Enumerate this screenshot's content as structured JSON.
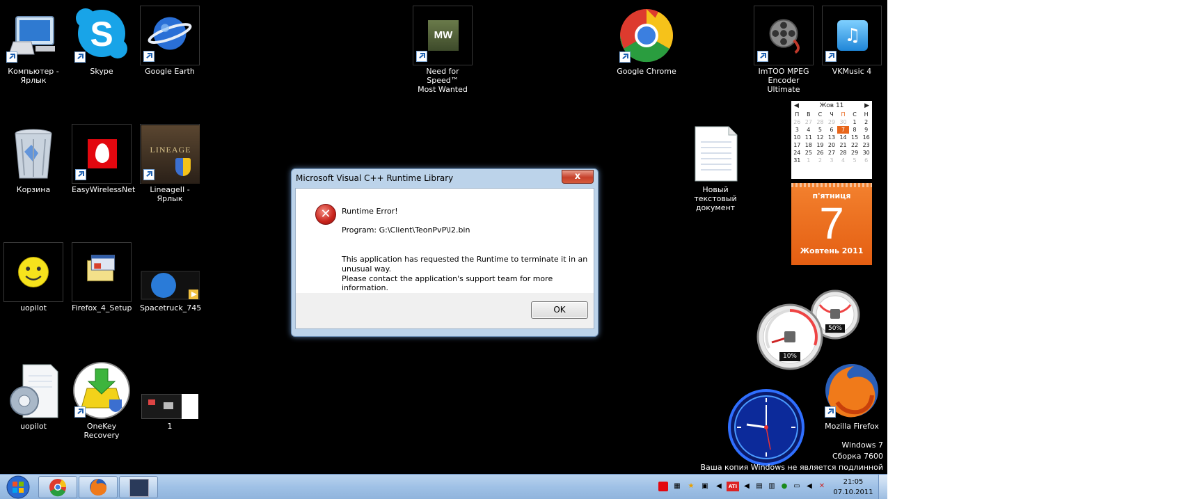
{
  "desktop": {
    "icons": [
      {
        "label": "Компьютер -\nЯрлык"
      },
      {
        "label": "Skype"
      },
      {
        "label": "Google Earth"
      },
      {
        "label": "Need for Speed™\nMost Wanted",
        "thumb_text": "MW"
      },
      {
        "label": "Google Chrome"
      },
      {
        "label": "ImTOO MPEG\nEncoder Ultimate"
      },
      {
        "label": "VKMusic 4"
      },
      {
        "label": "Корзина"
      },
      {
        "label": "EasyWirelessNet"
      },
      {
        "label": "LineageII - Ярлык",
        "thumb_text": "LINEAGE"
      },
      {
        "label": "Новый текстовый\nдокумент"
      },
      {
        "label": "uopilot"
      },
      {
        "label": "Firefox_4_Setup"
      },
      {
        "label": "Spacetruck_745"
      },
      {
        "label": "uopilot"
      },
      {
        "label": "OneKey Recovery"
      },
      {
        "label": "1"
      },
      {
        "label": "Mozilla Firefox"
      }
    ]
  },
  "dialog": {
    "title": "Microsoft Visual C++ Runtime Library",
    "close_glyph": "x",
    "heading": "Runtime Error!",
    "program": "Program: G:\\Client\\TeonPvP\\l2.bin",
    "message_line1": "This application has requested the Runtime to terminate it in an",
    "message_line2": "unusual way.",
    "message_line3": "Please contact the application's support team for more information.",
    "ok_label": "OK"
  },
  "calendar_gadget": {
    "month_header": "Жов 11",
    "weekday_headers": [
      "П",
      "В",
      "С",
      "Ч",
      "П",
      "С",
      "Н"
    ],
    "weeks": [
      [
        "26",
        "27",
        "28",
        "29",
        "30",
        "1",
        "2"
      ],
      [
        "3",
        "4",
        "5",
        "6",
        "7",
        "8",
        "9"
      ],
      [
        "10",
        "11",
        "12",
        "13",
        "14",
        "15",
        "16"
      ],
      [
        "17",
        "18",
        "19",
        "20",
        "21",
        "22",
        "23"
      ],
      [
        "24",
        "25",
        "26",
        "27",
        "28",
        "29",
        "30"
      ],
      [
        "31",
        "1",
        "2",
        "3",
        "4",
        "5",
        "6"
      ]
    ],
    "today": "7",
    "weekday_name": "п'ятниця",
    "big_day": "7",
    "month_year": "Жовтень 2011"
  },
  "cpu_meter": {
    "cpu": "10%",
    "memory": "50%"
  },
  "watermark": {
    "line1": "Windows 7",
    "line2": "Сборка 7600",
    "line3": "Ваша копия Windows не является подлинной"
  },
  "taskbar": {
    "time": "21:05",
    "date": "07.10.2011"
  },
  "colors": {
    "desktop_bg": "#000000",
    "calendar_accent": "#e8661b",
    "taskbar": "#a9c7ea",
    "error_red": "#c8231b"
  }
}
